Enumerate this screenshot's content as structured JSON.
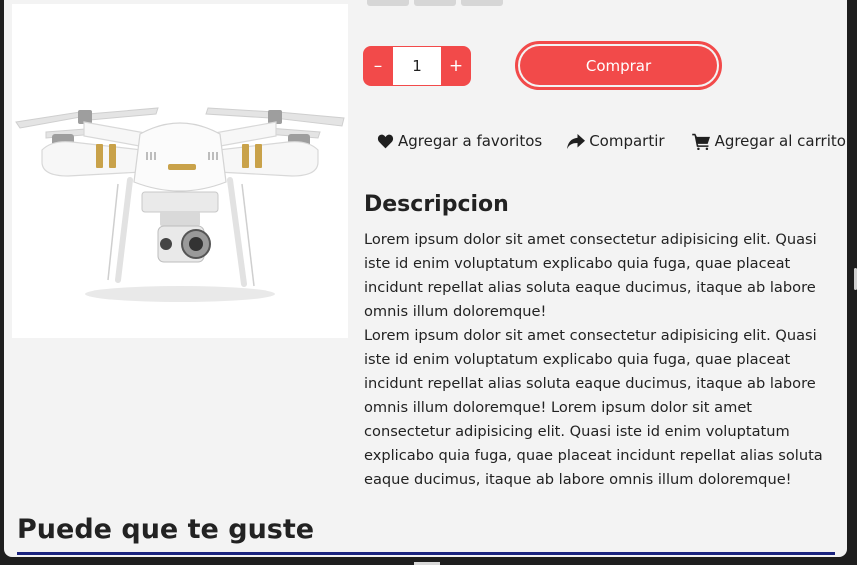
{
  "product": {
    "image_alt": "Drone",
    "quantity": "1",
    "decrement_label": "–",
    "increment_label": "+",
    "buy_label": "Comprar"
  },
  "actions": {
    "favorite": {
      "label": "Agregar a favoritos",
      "icon": "heart-icon"
    },
    "share": {
      "label": "Compartir",
      "icon": "share-icon"
    },
    "cart": {
      "label": "Agregar al carrito",
      "icon": "cart-icon"
    }
  },
  "description": {
    "title": "Descripcion",
    "paragraph1": "Lorem ipsum dolor sit amet consectetur adipisicing elit. Quasi iste id enim voluptatum explicabo quia fuga, quae placeat incidunt repellat alias soluta eaque ducimus, itaque ab labore omnis illum doloremque!",
    "paragraph2": "Lorem ipsum dolor sit amet consectetur adipisicing elit. Quasi iste id enim voluptatum explicabo quia fuga, quae placeat incidunt repellat alias soluta eaque ducimus, itaque ab labore omnis illum doloremque! Lorem ipsum dolor sit amet consectetur adipisicing elit. Quasi iste id enim voluptatum explicabo quia fuga, quae placeat incidunt repellat alias soluta eaque ducimus, itaque ab labore omnis illum doloremque!"
  },
  "related": {
    "title": "Puede que te guste"
  },
  "colors": {
    "accent": "#f24a4a",
    "underline": "#1a237e",
    "panel": "#f3f3f3"
  }
}
